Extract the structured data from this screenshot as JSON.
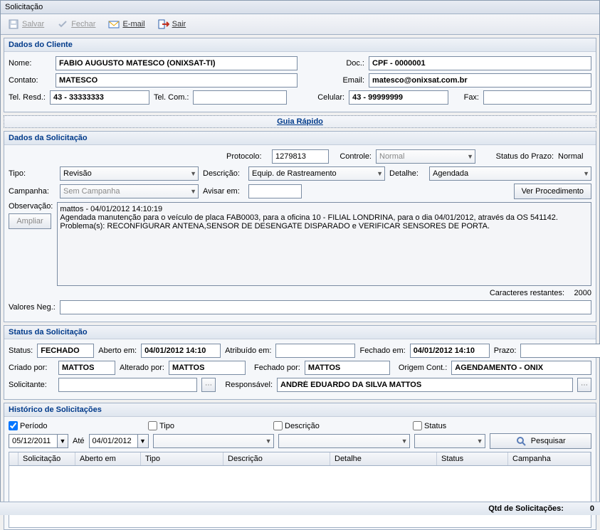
{
  "window": {
    "title": "Solicitação"
  },
  "toolbar": {
    "salvar": "Salvar",
    "fechar": "Fechar",
    "email": "E-mail",
    "sair": "Sair"
  },
  "cliente": {
    "header": "Dados do Cliente",
    "nome_lbl": "Nome:",
    "nome": "FABIO AUGUSTO MATESCO (ONIXSAT-TI)",
    "doc_lbl": "Doc.:",
    "doc": "CPF - 0000001",
    "contato_lbl": "Contato:",
    "contato": "MATESCO",
    "email_lbl": "Email:",
    "email": "matesco@onixsat.com.br",
    "telresd_lbl": "Tel. Resd.:",
    "telresd": "43 - 33333333",
    "telcom_lbl": "Tel. Com.:",
    "telcom": "",
    "celular_lbl": "Celular:",
    "celular": "43 - 99999999",
    "fax_lbl": "Fax:",
    "fax": ""
  },
  "guia": "Guia Rápido",
  "solic": {
    "header": "Dados da Solicitação",
    "protocolo_lbl": "Protocolo:",
    "protocolo": "1279813",
    "controle_lbl": "Controle:",
    "controle": "Normal",
    "status_prazo_lbl": "Status do Prazo:",
    "status_prazo": "Normal",
    "tipo_lbl": "Tipo:",
    "tipo": "Revisão",
    "descricao_lbl": "Descrição:",
    "descricao": "Equip. de Rastreamento",
    "detalhe_lbl": "Detalhe:",
    "detalhe": "Agendada",
    "campanha_lbl": "Campanha:",
    "campanha": "Sem Campanha",
    "avisar_lbl": "Avisar em:",
    "avisar": "",
    "ver_proc": "Ver Procedimento",
    "obs_lbl": "Observação:",
    "ampliar": "Ampliar",
    "obs": "mattos - 04/01/2012 14:10:19\nAgendada manutenção para o veículo de placa FAB0003, para a oficina 10 - FILIAL LONDRINA, para o dia 04/01/2012, através da OS 541142.\nProblema(s): RECONFIGURAR ANTENA,SENSOR DE DESENGATE DISPARADO e VERIFICAR SENSORES DE PORTA.",
    "caracteres_lbl": "Caracteres restantes:",
    "caracteres": "2000",
    "valores_neg_lbl": "Valores Neg.:",
    "valores_neg": ""
  },
  "status": {
    "header": "Status da Solicitação",
    "status_lbl": "Status:",
    "status": "FECHADO",
    "aberto_em_lbl": "Aberto em:",
    "aberto_em": "04/01/2012 14:10",
    "atribuido_em_lbl": "Atribuído em:",
    "atribuido_em": "",
    "fechado_em_lbl": "Fechado em:",
    "fechado_em": "04/01/2012 14:10",
    "prazo_lbl": "Prazo:",
    "prazo": "",
    "criado_por_lbl": "Criado por:",
    "criado_por": "MATTOS",
    "alterado_por_lbl": "Alterado por:",
    "alterado_por": "MATTOS",
    "fechado_por_lbl": "Fechado por:",
    "fechado_por": "MATTOS",
    "origem_lbl": "Origem Cont.:",
    "origem": "AGENDAMENTO - ONIX",
    "solicitante_lbl": "Solicitante:",
    "solicitante": "",
    "responsavel_lbl": "Responsável:",
    "responsavel": "ANDRÉ EDUARDO DA SILVA MATTOS"
  },
  "hist": {
    "header": "Histórico de Solicitações",
    "periodo_lbl": "Período",
    "tipo_lbl": "Tipo",
    "descricao_lbl": "Descrição",
    "status_lbl": "Status",
    "de": "05/12/2011",
    "ate_lbl": "Até",
    "ate": "04/01/2012",
    "pesquisar": "Pesquisar",
    "cols": {
      "solicitacao": "Solicitação",
      "aberto": "Aberto em",
      "tipo": "Tipo",
      "descricao": "Descrição",
      "detalhe": "Detalhe",
      "status": "Status",
      "campanha": "Campanha"
    }
  },
  "footer": {
    "qtd_lbl": "Qtd de Solicitações:",
    "qtd": "0"
  }
}
